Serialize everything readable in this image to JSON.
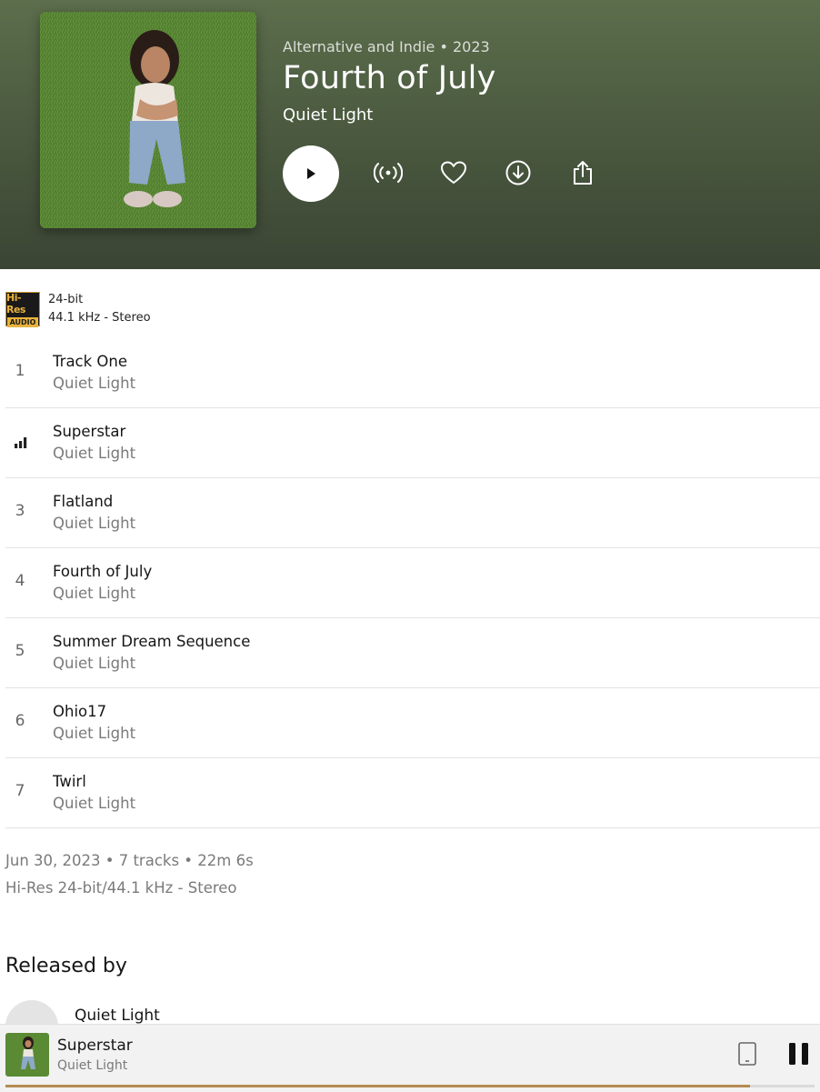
{
  "album": {
    "genre_year": "Alternative and Indie • 2023",
    "title": "Fourth of July",
    "artist": "Quiet Light"
  },
  "quality": {
    "badge_top": "Hi-Res",
    "badge_bottom": "AUDIO",
    "bit_depth": "24-bit",
    "sample_rate": "44.1 kHz - Stereo"
  },
  "tracks": [
    {
      "number": "1",
      "title": "Track One",
      "artist": "Quiet Light"
    },
    {
      "number": "2",
      "title": "Superstar",
      "artist": "Quiet Light",
      "playing": true
    },
    {
      "number": "3",
      "title": "Flatland",
      "artist": "Quiet Light"
    },
    {
      "number": "4",
      "title": "Fourth of July",
      "artist": "Quiet Light"
    },
    {
      "number": "5",
      "title": "Summer Dream Sequence",
      "artist": "Quiet Light"
    },
    {
      "number": "6",
      "title": "Ohio17",
      "artist": "Quiet Light"
    },
    {
      "number": "7",
      "title": "Twirl",
      "artist": "Quiet Light"
    }
  ],
  "album_info": {
    "summary": "Jun 30, 2023 • 7 tracks • 22m 6s",
    "format": "Hi-Res 24-bit/44.1 kHz - Stereo"
  },
  "released_by": {
    "heading": "Released by",
    "label": "Quiet Light"
  },
  "now_playing": {
    "title": "Superstar",
    "artist": "Quiet Light",
    "progress": 0.92
  },
  "icons": {
    "play": "play-icon",
    "broadcast": "broadcast-icon",
    "favorite": "heart-icon",
    "download": "download-icon",
    "share": "share-icon",
    "device": "device-icon",
    "pause": "pause-icon",
    "now_playing": "equalizer-icon"
  },
  "colors": {
    "header_top": "#5c6e4c",
    "header_bottom": "#3b4534",
    "progress": "#b58a52",
    "hires_gold": "#e8b33c"
  }
}
